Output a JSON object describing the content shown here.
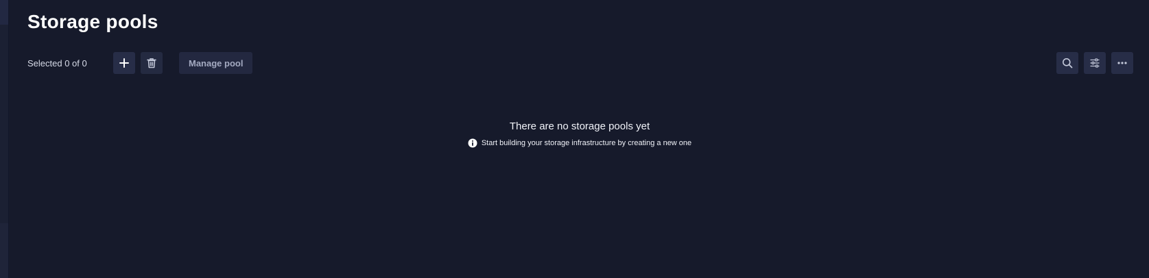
{
  "page": {
    "title": "Storage pools"
  },
  "toolbar": {
    "selected_text": "Selected 0 of 0",
    "add_icon": "plus-icon",
    "delete_icon": "trash-icon",
    "manage_label": "Manage pool",
    "search_icon": "search-icon",
    "filter_icon": "sliders-icon",
    "more_icon": "ellipsis-icon"
  },
  "empty_state": {
    "title": "There are no storage pools yet",
    "hint": "Start building your storage infrastructure by creating a new one",
    "hint_icon": "info-icon"
  },
  "colors": {
    "background": "#161a2b",
    "button": "#272d47",
    "text": "#ffffff",
    "muted_text": "#a4aac1"
  }
}
